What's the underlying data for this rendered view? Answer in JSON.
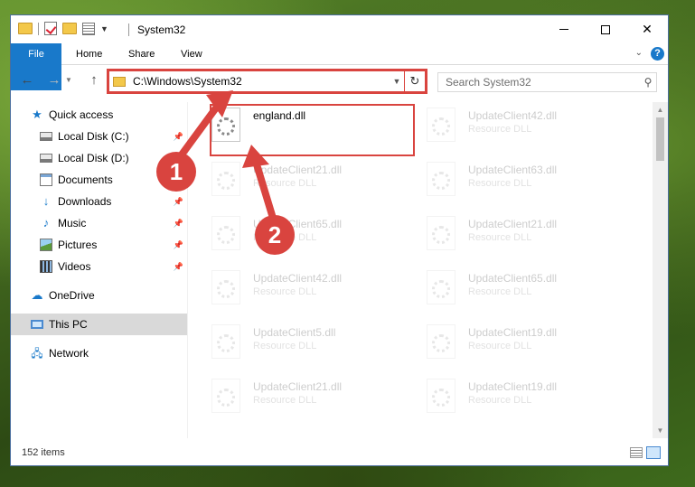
{
  "window": {
    "title": "System32",
    "controls": {
      "minimize": "—",
      "maximize": "☐",
      "close": "✕"
    }
  },
  "ribbon": {
    "tabs": [
      {
        "label": "File",
        "active": true
      },
      {
        "label": "Home"
      },
      {
        "label": "Share"
      },
      {
        "label": "View"
      }
    ],
    "help": "?"
  },
  "address": {
    "path": "C:\\Windows\\System32",
    "search_placeholder": "Search System32"
  },
  "nav": {
    "items": [
      {
        "label": "Quick access",
        "icon": "star-icon"
      },
      {
        "label": "Local Disk (C:)",
        "icon": "disk-icon",
        "pinned": true
      },
      {
        "label": "Local Disk (D:)",
        "icon": "disk-icon"
      },
      {
        "label": "Documents",
        "icon": "documents-icon"
      },
      {
        "label": "Downloads",
        "icon": "download-icon",
        "pinned": true
      },
      {
        "label": "Music",
        "icon": "music-icon",
        "pinned": true
      },
      {
        "label": "Pictures",
        "icon": "pictures-icon",
        "pinned": true
      },
      {
        "label": "Videos",
        "icon": "videos-icon",
        "pinned": true
      },
      {
        "label": "OneDrive",
        "icon": "cloud-icon"
      },
      {
        "label": "This PC",
        "icon": "computer-icon",
        "selected": true
      },
      {
        "label": "Network",
        "icon": "network-icon"
      }
    ]
  },
  "files": [
    {
      "name": "england.dll",
      "type": "",
      "highlighted": true
    },
    {
      "name": "UpdateClient42.dll",
      "type": "Resource DLL"
    },
    {
      "name": "UpdateClient21.dll",
      "type": "Resource DLL"
    },
    {
      "name": "UpdateClient63.dll",
      "type": "Resource DLL"
    },
    {
      "name": "UpdateClient65.dll",
      "type": "Resource DLL"
    },
    {
      "name": "UpdateClient21.dll",
      "type": "Resource DLL"
    },
    {
      "name": "UpdateClient42.dll",
      "type": "Resource DLL"
    },
    {
      "name": "UpdateClient65.dll",
      "type": "Resource DLL"
    },
    {
      "name": "UpdateClient5.dll",
      "type": "Resource DLL"
    },
    {
      "name": "UpdateClient19.dll",
      "type": "Resource DLL"
    },
    {
      "name": "UpdateClient21.dll",
      "type": "Resource DLL"
    },
    {
      "name": "UpdateClient19.dll",
      "type": "Resource DLL"
    }
  ],
  "status": {
    "item_count": "152 items"
  },
  "annotations": {
    "step1": "1",
    "step2": "2",
    "color": "#d9443f"
  },
  "colors": {
    "accent": "#1979ca",
    "highlight": "#d9443f",
    "selection": "#d9d9d9"
  }
}
